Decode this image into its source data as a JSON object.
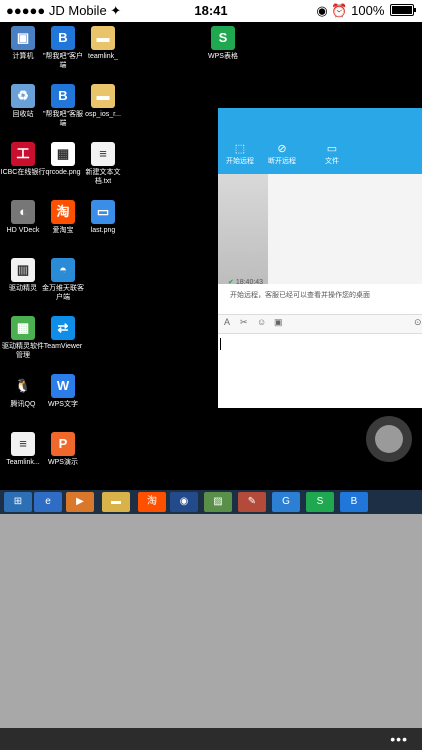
{
  "status": {
    "carrier": "●●●●● JD Mobile ✦",
    "time": "18:41",
    "battery": "100%",
    "icons": "◉ ⏰"
  },
  "desktop_icons": [
    {
      "label": "计算机",
      "icon": "computer-icon",
      "color": "#4a7fc1",
      "glyph": "▣"
    },
    {
      "label": "\"帮我吧\"客户端",
      "icon": "bangwoba-icon",
      "color": "#2176d9",
      "glyph": "B"
    },
    {
      "label": "teamlink_",
      "icon": "folder-icon",
      "color": "#e9c46a",
      "glyph": "▬"
    },
    {
      "label": "WPS表格",
      "icon": "wps-sheet-icon",
      "color": "#1fa84f",
      "glyph": "S"
    },
    {
      "label": "回收站",
      "icon": "recycle-bin-icon",
      "color": "#6aa0d8",
      "glyph": "♻"
    },
    {
      "label": "\"帮我吧\"客服端",
      "icon": "bangwoba-service-icon",
      "color": "#2176d9",
      "glyph": "B"
    },
    {
      "label": "osp_ios_r...",
      "icon": "folder-icon",
      "color": "#e9c46a",
      "glyph": "▬"
    },
    {
      "label": "ICBC在线银行",
      "icon": "icbc-icon",
      "color": "#c8102e",
      "glyph": "工"
    },
    {
      "label": "qrcode.png",
      "icon": "qrcode-icon",
      "color": "#ffffff",
      "glyph": "▦"
    },
    {
      "label": "新建文本文档.txt",
      "icon": "text-file-icon",
      "color": "#f2f2f2",
      "glyph": "≡"
    },
    {
      "label": "HD VDeck",
      "icon": "vdeck-icon",
      "color": "#777777",
      "glyph": "◐"
    },
    {
      "label": "爱淘宝",
      "icon": "taobao-icon",
      "color": "#ff5000",
      "glyph": "淘"
    },
    {
      "label": "last.png",
      "icon": "image-file-icon",
      "color": "#3b8ee8",
      "glyph": "▭"
    },
    {
      "label": "驱动精灵",
      "icon": "driver-icon",
      "color": "#f2f2f2",
      "glyph": "▥"
    },
    {
      "label": "金万维天联客户端",
      "icon": "jinwanwei-icon",
      "color": "#2a8bd6",
      "glyph": "◓"
    },
    {
      "label": "驱动精灵软件管理",
      "icon": "driver-manager-icon",
      "color": "#4caf50",
      "glyph": "▦"
    },
    {
      "label": "TeamViewer",
      "icon": "teamviewer-icon",
      "color": "#0e8ee9",
      "glyph": "⇄"
    },
    {
      "label": "腾讯QQ",
      "icon": "qq-icon",
      "color": "#000000",
      "glyph": "🐧"
    },
    {
      "label": "WPS文字",
      "icon": "wps-writer-icon",
      "color": "#2b7de9",
      "glyph": "W"
    },
    {
      "label": "Teamlink...",
      "icon": "text-file-icon",
      "color": "#f2f2f2",
      "glyph": "≡"
    },
    {
      "label": "WPS演示",
      "icon": "wps-presentation-icon",
      "color": "#f0682c",
      "glyph": "P"
    }
  ],
  "remote_window": {
    "tabs": [
      {
        "label": "开始远程",
        "icon": "screen-icon",
        "glyph": "⬚"
      },
      {
        "label": "断开远程",
        "icon": "disconnect-icon",
        "glyph": "⊘"
      },
      {
        "label": "文件",
        "icon": "folder-icon",
        "glyph": "▭"
      }
    ],
    "message_time": "18:40:43",
    "message_text": "开始远程，客服已经可以查看并操作您的桌面",
    "toolbar": {
      "font": "A",
      "cut": "✂",
      "emoji": "☺",
      "screen": "▣",
      "more": "⊙"
    }
  },
  "taskbar_items": [
    {
      "name": "start-button",
      "color": "#2c6fb5",
      "glyph": "⊞"
    },
    {
      "name": "ie-icon",
      "color": "#2f6dc4",
      "glyph": "e"
    },
    {
      "name": "media-player-icon",
      "color": "#d9772b",
      "glyph": "▶"
    },
    {
      "name": "explorer-icon",
      "color": "#d9b34a",
      "glyph": "▬"
    },
    {
      "name": "taobao-icon",
      "color": "#ff5000",
      "glyph": "淘"
    },
    {
      "name": "browser-icon",
      "color": "#234a8a",
      "glyph": "◉"
    },
    {
      "name": "image-viewer-icon",
      "color": "#5a8f4a",
      "glyph": "▨"
    },
    {
      "name": "paint-icon",
      "color": "#b44a3a",
      "glyph": "✎"
    },
    {
      "name": "remote-app-icon",
      "color": "#2c7fd3",
      "glyph": "G"
    },
    {
      "name": "wps-sheet-icon",
      "color": "#1fa84f",
      "glyph": "S"
    },
    {
      "name": "bangwoba-icon",
      "color": "#2176d9",
      "glyph": "B"
    }
  ],
  "bottom_bar": {
    "more": "•••"
  }
}
